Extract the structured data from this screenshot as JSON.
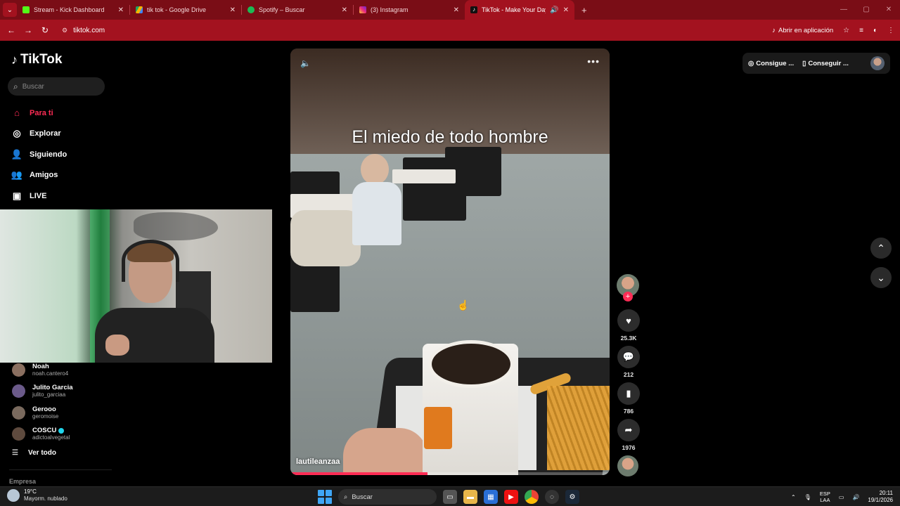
{
  "browser": {
    "tabs": [
      {
        "label": "Stream - Kick Dashboard",
        "icon": "kick-icon",
        "color": "#53fc18"
      },
      {
        "label": "tik tok - Google Drive",
        "icon": "google-drive-icon",
        "color": "#f4b400"
      },
      {
        "label": "Spotify – Buscar",
        "icon": "spotify-icon",
        "color": "#1db954"
      },
      {
        "label": "(3) Instagram",
        "icon": "instagram-icon",
        "color": "#e1306c"
      },
      {
        "label": "TikTok - Make Your Day",
        "icon": "tiktok-icon",
        "color": "#ffffff",
        "active": true
      }
    ],
    "url": "tiktok.com",
    "open_app_label": "Abrir en aplicación",
    "theme_color": "#a3121f"
  },
  "tiktok": {
    "logo": "TikTok",
    "search_placeholder": "Buscar",
    "nav": [
      {
        "label": "Para ti",
        "icon": "home-icon",
        "active": true
      },
      {
        "label": "Explorar",
        "icon": "compass-icon"
      },
      {
        "label": "Siguiendo",
        "icon": "following-icon"
      },
      {
        "label": "Amigos",
        "icon": "friends-icon"
      },
      {
        "label": "LIVE",
        "icon": "live-icon"
      }
    ],
    "following": [
      {
        "name": "Noah",
        "handle": "noah.cantero4",
        "color": "#8a6f60"
      },
      {
        "name": "Julito Garcia",
        "handle": "julito_garciaa",
        "color": "#6b5a8a"
      },
      {
        "name": "Gerooo",
        "handle": "geromoise",
        "color": "#7a6a5e"
      },
      {
        "name": "COSCU",
        "handle": "adictoalvegetal",
        "color": "#5e4a3e",
        "verified": true
      }
    ],
    "view_all": "Ver todo",
    "company_label": "Empresa",
    "video": {
      "caption": "El miedo de todo hombre",
      "author": "lautileanzaa",
      "progress_fraction": 0.43
    },
    "actions": {
      "likes": "25.3K",
      "comments": "212",
      "saves": "786",
      "shares": "1976"
    },
    "top_right": {
      "get_coins": "Consigue ...",
      "get_app": "Conseguir ..."
    },
    "accent": "#fe2c55"
  },
  "taskbar": {
    "temperature": "19°C",
    "condition": "Mayorm. nublado",
    "search": "Buscar",
    "language": "ESP",
    "layout": "LAA",
    "time": "20:11",
    "date": "19/1/2026"
  }
}
